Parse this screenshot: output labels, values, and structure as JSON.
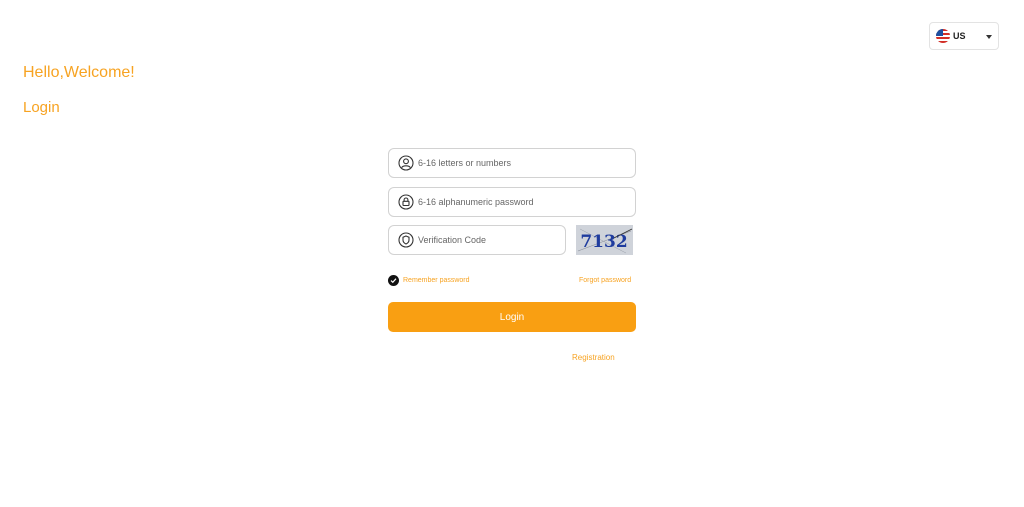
{
  "language": {
    "code": "US",
    "flag_icon": "us-flag-icon"
  },
  "header": {
    "greeting": "Hello,Welcome!",
    "title": "Login"
  },
  "form": {
    "username_placeholder": "6-16 letters or numbers",
    "password_placeholder": "6-16 alphanumeric password",
    "code_placeholder": "Verification Code",
    "captcha_text": "7132",
    "remember_label": "Remember password",
    "forgot_label": "Forgot password",
    "login_label": "Login",
    "register_label": "Registration"
  },
  "colors": {
    "accent": "#f7a322",
    "button": "#f99f12"
  }
}
